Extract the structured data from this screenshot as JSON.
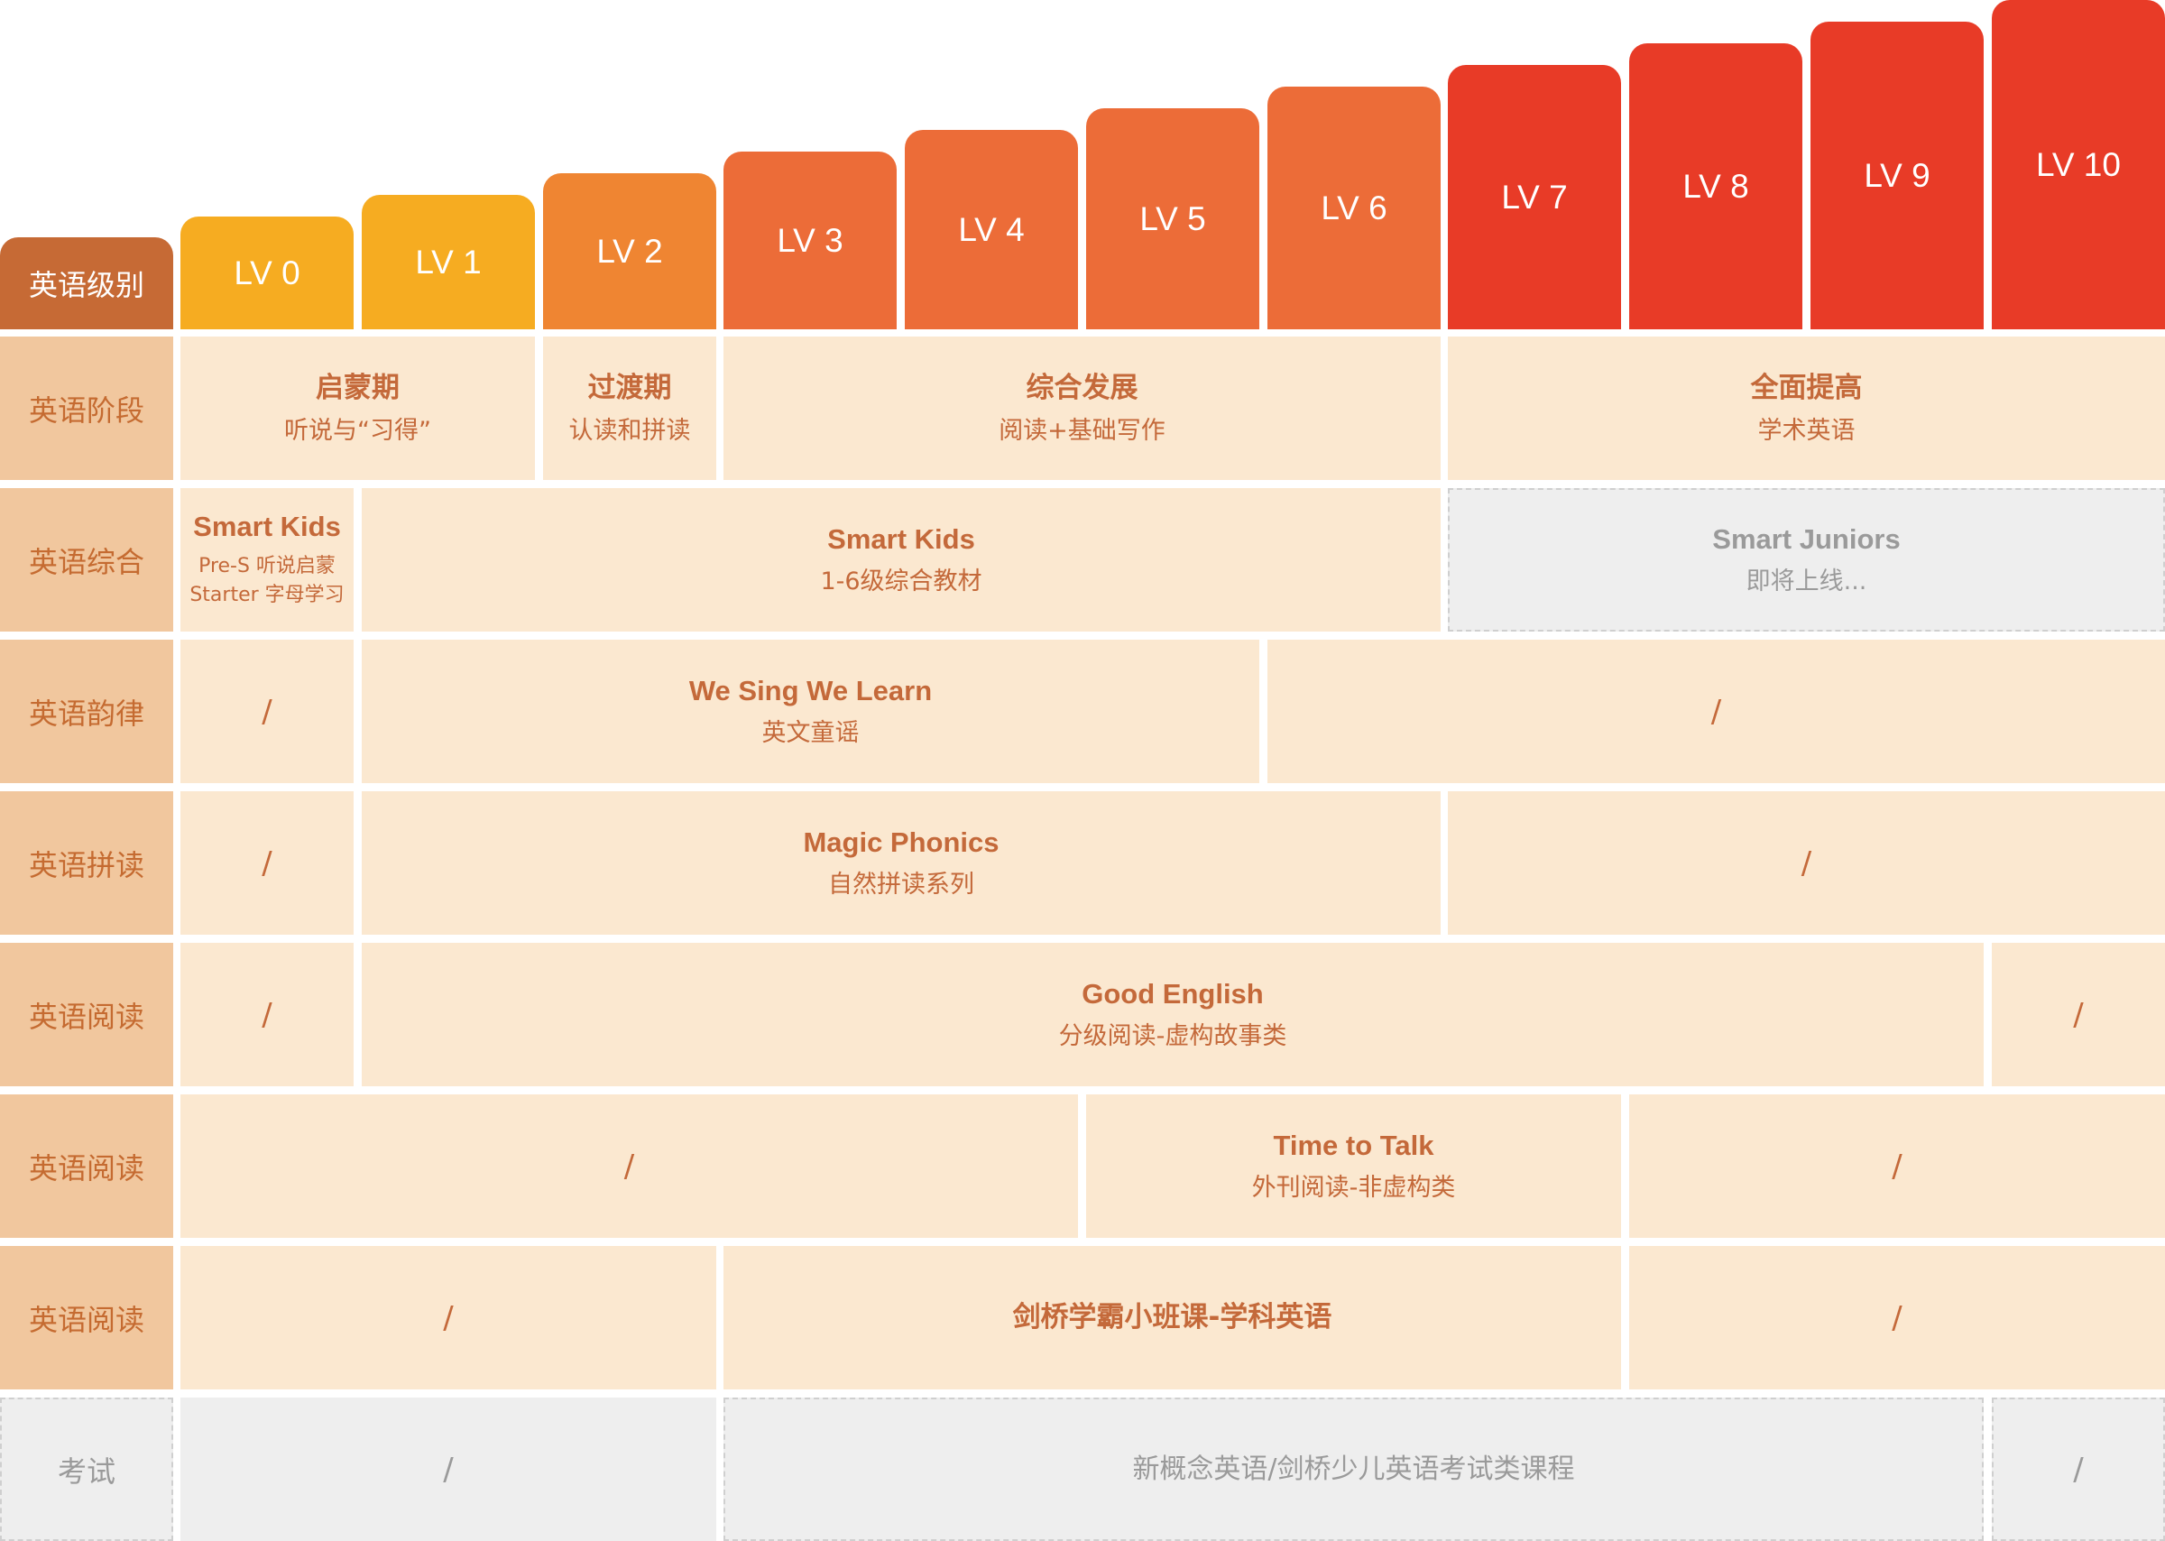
{
  "colors": {
    "yellow": "#f6ac21",
    "light_orange": "#ef8532",
    "orange": "#ec6c38",
    "red": "#e83b27",
    "header_label": "#c66a35",
    "row_label": "#f1c79e",
    "cell": "#fbe8d0",
    "text_accent": "#c4693a",
    "grey": "#eeeeee"
  },
  "header": {
    "label": "英语级别"
  },
  "levels": [
    "LV 0",
    "LV 1",
    "LV 2",
    "LV 3",
    "LV 4",
    "LV 5",
    "LV 6",
    "LV 7",
    "LV 8",
    "LV 9",
    "LV 10"
  ],
  "rows": {
    "stage": {
      "label": "英语阶段",
      "cells": [
        {
          "title": "启蒙期",
          "sub": "听说与“习得”"
        },
        {
          "title": "过渡期",
          "sub": "认读和拼读"
        },
        {
          "title": "综合发展",
          "sub": "阅读+基础写作"
        },
        {
          "title": "全面提高",
          "sub": "学术英语"
        }
      ]
    },
    "integrated": {
      "label": "英语综合",
      "cells": [
        {
          "title": "Smart Kids",
          "line1": "Pre-S 听说启蒙",
          "line2": "Starter 字母学习"
        },
        {
          "title": "Smart Kids",
          "sub": "1-6级综合教材"
        },
        {
          "title": "Smart Juniors",
          "sub": "即将上线..."
        }
      ]
    },
    "rhythm": {
      "label": "英语韵律",
      "cells": [
        {
          "title": "/"
        },
        {
          "title": "We Sing We Learn",
          "sub": "英文童谣"
        },
        {
          "title": "/"
        }
      ]
    },
    "phonics": {
      "label": "英语拼读",
      "cells": [
        {
          "title": "/"
        },
        {
          "title": "Magic Phonics",
          "sub": "自然拼读系列"
        },
        {
          "title": "/"
        }
      ]
    },
    "reading1": {
      "label": "英语阅读",
      "cells": [
        {
          "title": "/"
        },
        {
          "title": "Good English",
          "sub": "分级阅读-虚构故事类"
        },
        {
          "title": "/"
        }
      ]
    },
    "reading2": {
      "label": "英语阅读",
      "cells": [
        {
          "title": "/"
        },
        {
          "title": "Time to Talk",
          "sub": "外刊阅读-非虚构类"
        },
        {
          "title": "/"
        }
      ]
    },
    "reading3": {
      "label": "英语阅读",
      "cells": [
        {
          "title": "/"
        },
        {
          "title": "剑桥学霸小班课-学科英语"
        },
        {
          "title": "/"
        }
      ]
    },
    "exam": {
      "label": "考试",
      "cells": [
        {
          "title": "/"
        },
        {
          "title": "新概念英语/剑桥少儿英语考试类课程"
        },
        {
          "title": "/"
        }
      ]
    }
  }
}
